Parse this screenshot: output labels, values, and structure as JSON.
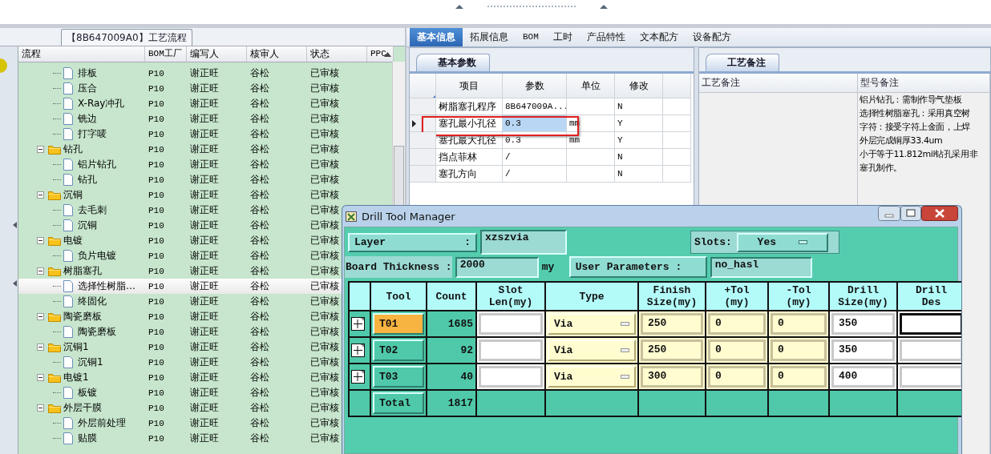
{
  "process_panel": {
    "title": "【8B647009A0】工艺流程",
    "columns": [
      "流程",
      "BOM工厂",
      "编写人",
      "核审人",
      "状态",
      "PPC"
    ],
    "rows": [
      {
        "kind": "file",
        "label": "排板",
        "bom": "P10",
        "writer": "谢正旺",
        "reviewer": "谷松",
        "status": "已审核",
        "selected": false
      },
      {
        "kind": "file",
        "label": "压合",
        "bom": "P10",
        "writer": "谢正旺",
        "reviewer": "谷松",
        "status": "已审核",
        "selected": false
      },
      {
        "kind": "file",
        "label": "X-Ray冲孔",
        "bom": "P10",
        "writer": "谢正旺",
        "reviewer": "谷松",
        "status": "已审核",
        "selected": false
      },
      {
        "kind": "file",
        "label": "铣边",
        "bom": "P10",
        "writer": "谢正旺",
        "reviewer": "谷松",
        "status": "已审核",
        "selected": false
      },
      {
        "kind": "file",
        "label": "打字唛",
        "bom": "P10",
        "writer": "谢正旺",
        "reviewer": "谷松",
        "status": "已审核",
        "selected": false
      },
      {
        "kind": "folder",
        "label": "钻孔",
        "bom": "P10",
        "writer": "谢正旺",
        "reviewer": "谷松",
        "status": "已审核",
        "selected": false,
        "expanded": true,
        "children": [
          {
            "kind": "file",
            "label": "铝片钻孔",
            "bom": "P10",
            "writer": "谢正旺",
            "reviewer": "谷松",
            "status": "已审核",
            "selected": false
          },
          {
            "kind": "file",
            "label": "钻孔",
            "bom": "P10",
            "writer": "谢正旺",
            "reviewer": "谷松",
            "status": "已审核",
            "selected": false
          }
        ]
      },
      {
        "kind": "folder",
        "label": "沉铜",
        "bom": "P10",
        "writer": "谢正旺",
        "reviewer": "谷松",
        "status": "已审核",
        "selected": false,
        "expanded": true,
        "children": [
          {
            "kind": "file",
            "label": "去毛刺",
            "bom": "P10",
            "writer": "谢正旺",
            "reviewer": "谷松",
            "status": "已审核",
            "selected": false
          },
          {
            "kind": "file",
            "label": "沉铜",
            "bom": "P10",
            "writer": "谢正旺",
            "reviewer": "谷松",
            "status": "已审核",
            "selected": false
          }
        ]
      },
      {
        "kind": "folder",
        "label": "电镀",
        "bom": "P10",
        "writer": "谢正旺",
        "reviewer": "谷松",
        "status": "已审核",
        "selected": false,
        "expanded": true,
        "children": [
          {
            "kind": "file",
            "label": "负片电镀",
            "bom": "P10",
            "writer": "谢正旺",
            "reviewer": "谷松",
            "status": "已审核",
            "selected": false
          }
        ]
      },
      {
        "kind": "folder",
        "label": "树脂塞孔",
        "bom": "P10",
        "writer": "谢正旺",
        "reviewer": "谷松",
        "status": "已审核",
        "selected": false,
        "expanded": true,
        "children": [
          {
            "kind": "file",
            "label": "选择性树脂…",
            "bom": "P10",
            "writer": "谢正旺",
            "reviewer": "谷松",
            "status": "已审核",
            "selected": true
          },
          {
            "kind": "file",
            "label": "终固化",
            "bom": "P10",
            "writer": "谢正旺",
            "reviewer": "谷松",
            "status": "已审核",
            "selected": false
          }
        ]
      },
      {
        "kind": "folder",
        "label": "陶瓷磨板",
        "bom": "P10",
        "writer": "谢正旺",
        "reviewer": "谷松",
        "status": "已审核",
        "selected": false,
        "expanded": true,
        "children": [
          {
            "kind": "file",
            "label": "陶瓷磨板",
            "bom": "P10",
            "writer": "谢正旺",
            "reviewer": "谷松",
            "status": "已审核",
            "selected": false
          }
        ]
      },
      {
        "kind": "folder",
        "label": "沉铜1",
        "bom": "P10",
        "writer": "谢正旺",
        "reviewer": "谷松",
        "status": "已审核",
        "selected": false,
        "expanded": true,
        "children": [
          {
            "kind": "file",
            "label": "沉铜1",
            "bom": "P10",
            "writer": "谢正旺",
            "reviewer": "谷松",
            "status": "已审核",
            "selected": false
          }
        ]
      },
      {
        "kind": "folder",
        "label": "电镀1",
        "bom": "P10",
        "writer": "谢正旺",
        "reviewer": "谷松",
        "status": "已审核",
        "selected": false,
        "expanded": true,
        "children": [
          {
            "kind": "file",
            "label": "板镀",
            "bom": "P10",
            "writer": "谢正旺",
            "reviewer": "谷松",
            "status": "已审核",
            "selected": false
          }
        ]
      },
      {
        "kind": "folder",
        "label": "外层干膜",
        "bom": "P10",
        "writer": "谢正旺",
        "reviewer": "谷松",
        "status": "已审核",
        "selected": false,
        "expanded": true,
        "children": [
          {
            "kind": "file",
            "label": "外层前处理",
            "bom": "P10",
            "writer": "谢正旺",
            "reviewer": "谷松",
            "status": "已审核",
            "selected": false
          },
          {
            "kind": "file",
            "label": "贴膜",
            "bom": "P10",
            "writer": "谢正旺",
            "reviewer": "谷松",
            "status": "已审核",
            "selected": false
          }
        ]
      }
    ]
  },
  "detail_panel": {
    "tabs": [
      {
        "label": "基本信息",
        "selected": true
      },
      {
        "label": "拓展信息",
        "selected": false
      },
      {
        "label": "BOM",
        "selected": false
      },
      {
        "label": "工时",
        "selected": false
      },
      {
        "label": "产品特性",
        "selected": false
      },
      {
        "label": "文本配方",
        "selected": false
      },
      {
        "label": "设备配方",
        "selected": false
      }
    ],
    "params": {
      "subtab": "基本参数",
      "columns": [
        "项目",
        "参数",
        "单位",
        "修改"
      ],
      "rows": [
        {
          "item": "树脂塞孔程序",
          "value": "8B647009A...",
          "modified": "N",
          "selected": false,
          "highlighted": false
        },
        {
          "item": "塞孔最小孔径",
          "value": "0.3",
          "unit": "mm",
          "modified": "Y",
          "selected": true,
          "highlighted": true
        },
        {
          "item": "塞孔最大孔径",
          "value": "0.3",
          "unit": "mm",
          "modified": "Y",
          "selected": false,
          "highlighted": false
        },
        {
          "item": "挡点菲林",
          "value": "/",
          "modified": "N",
          "selected": false,
          "highlighted": false
        },
        {
          "item": "塞孔方向",
          "value": "/",
          "modified": "N",
          "selected": false,
          "highlighted": false
        }
      ]
    },
    "notes": {
      "subtab": "工艺备注",
      "columns": [
        "工艺备注",
        "型号备注"
      ],
      "model_notes": [
        "铝片钻孔：需制作导气垫板",
        "选择性树脂塞孔：采用真空树",
        "字符：接受字符上金面，上焊",
        "外层完成铜厚33.4um",
        "小于等于11.812mil钻孔采用非",
        "塞孔制作。"
      ]
    }
  },
  "drill_window": {
    "title": "Drill Tool Manager",
    "layer_label": "Layer",
    "layer_separator": ":",
    "layer": "xzszvia",
    "slots_label": "Slots:",
    "slots": "Yes",
    "thickness_label": "Board Thickness :",
    "thickness": "2000",
    "thickness_unit": "my",
    "user_params_label": "User Parameters :",
    "user_params": "no_hasl",
    "columns": [
      "Tool",
      "Count",
      "Slot\nLen(my)",
      "Type",
      "Finish\nSize(my)",
      "+Tol\n(my)",
      "-Tol\n(my)",
      "Drill\nSize(my)",
      "Drill\nDes"
    ],
    "tools": [
      {
        "tool": "T01",
        "selected": true,
        "count": "1685",
        "type": "Via",
        "finish": "250",
        "plus_tol": "0",
        "minus_tol": "0",
        "drill_size": "350",
        "drill_des_focused": true
      },
      {
        "tool": "T02",
        "selected": false,
        "count": "92",
        "type": "Via",
        "finish": "250",
        "plus_tol": "0",
        "minus_tol": "0",
        "drill_size": "350",
        "drill_des_focused": false
      },
      {
        "tool": "T03",
        "selected": false,
        "count": "40",
        "type": "Via",
        "finish": "300",
        "plus_tol": "0",
        "minus_tol": "0",
        "drill_size": "400",
        "drill_des_focused": false
      }
    ],
    "total_label": "Total",
    "total_count": "1817"
  }
}
